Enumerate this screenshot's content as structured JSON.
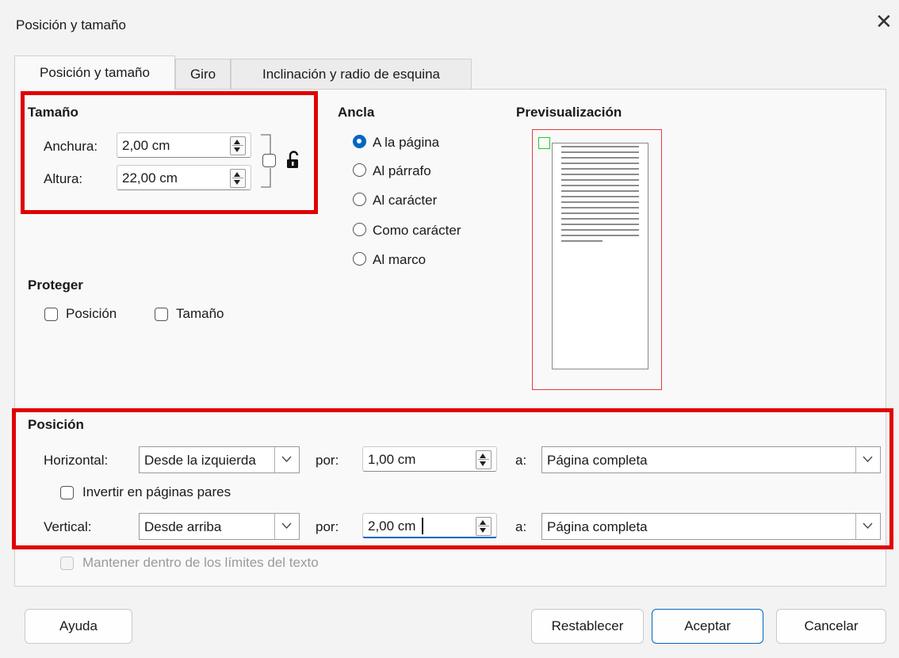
{
  "window": {
    "title": "Posición y tamaño",
    "close_glyph": "✕"
  },
  "tabs": [
    {
      "label": "Posición y tamaño",
      "active": true
    },
    {
      "label": "Giro",
      "active": false
    },
    {
      "label": "Inclinación y radio de esquina",
      "active": false
    }
  ],
  "size": {
    "heading": "Tamaño",
    "width_label": "Anchura:",
    "width_value": "2,00 cm",
    "height_label": "Altura:",
    "height_value": "22,00 cm",
    "keep_ratio_icon": "lock-open-icon"
  },
  "anchor": {
    "heading": "Ancla",
    "options": [
      {
        "label": "A la página",
        "selected": true
      },
      {
        "label": "Al párrafo",
        "selected": false
      },
      {
        "label": "Al carácter",
        "selected": false
      },
      {
        "label": "Como carácter",
        "selected": false
      },
      {
        "label": "Al marco",
        "selected": false
      }
    ]
  },
  "preview": {
    "heading": "Previsualización"
  },
  "protect": {
    "heading": "Proteger",
    "position_label": "Posición",
    "size_label": "Tamaño"
  },
  "position": {
    "heading": "Posición",
    "horizontal_label": "Horizontal:",
    "horizontal_value": "Desde la izquierda",
    "by_label": "por:",
    "horizontal_by": "1,00 cm",
    "to_label": "a:",
    "horizontal_to": "Página completa",
    "mirror_label": "Invertir en páginas pares",
    "vertical_label": "Vertical:",
    "vertical_value": "Desde arriba",
    "vertical_by": "2,00 cm",
    "vertical_to": "Página completa",
    "keep_inside_label": "Mantener dentro de los límites del texto"
  },
  "buttons": {
    "help": "Ayuda",
    "reset": "Restablecer",
    "ok": "Aceptar",
    "cancel": "Cancelar"
  },
  "colors": {
    "accent": "#0067c0",
    "highlight": "#e00000",
    "anchor_marker": "#22cc22"
  }
}
